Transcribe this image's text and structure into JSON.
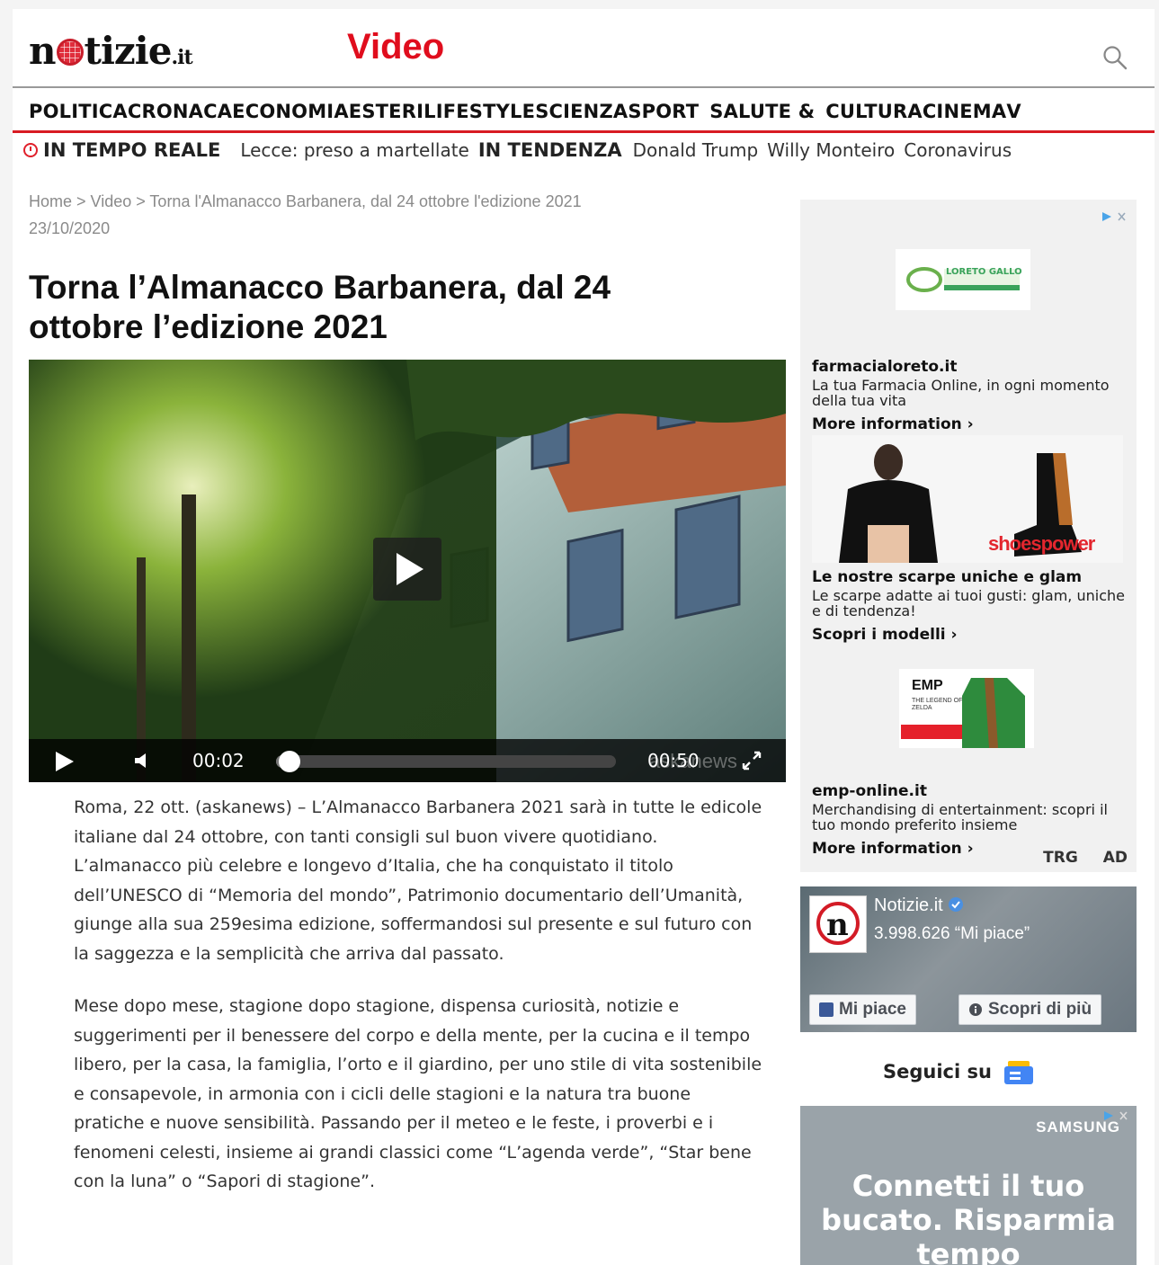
{
  "header": {
    "logo_text_left": "n",
    "logo_text_right": "tizie",
    "logo_tld": ".it",
    "section": "Video"
  },
  "nav": {
    "items": [
      "POLITICA",
      "CRONACA",
      "ECONOMIA",
      "ESTERI",
      "LIFESTYLE",
      "SCIENZA",
      "SPORT",
      "SALUTE &",
      "CULTURA",
      "CINEMA",
      "V"
    ]
  },
  "ticker": {
    "realtime_label": "IN TEMPO REALE",
    "realtime_item": "Lecce: preso a martellate",
    "trending_label": "IN TENDENZA",
    "trending_items": [
      "Donald Trump",
      "Willy Monteiro",
      "Coronavirus"
    ]
  },
  "breadcrumb": {
    "text": "Home > Video > Torna l'Almanacco Barbanera, dal 24 ottobre l'edizione 2021",
    "date": "23/10/2020"
  },
  "article": {
    "title": "Torna l’Almanacco Barbanera, dal 24 ottobre l’edizione 2021",
    "paragraphs": [
      "Roma, 22 ott. (askanews) – L’Almanacco Barbanera 2021 sarà in tutte le edicole italiane dal 24 ottobre, con tanti consigli sul buon vivere quotidiano. L’almanacco più celebre e longevo d’Italia, che ha conquistato il titolo dell’UNESCO di “Memoria del mondo”, Patrimonio documentario dell’Umanità, giunge alla sua 259esima edizione, soffermandosi sul presente e sul futuro con la saggezza e la semplicità che arriva dal passato.",
      "Mese dopo mese, stagione dopo stagione, dispensa curiosità, notizie e suggerimenti per il benessere del corpo e della mente, per la cucina e il tempo libero, per la casa, la famiglia, l’orto e il giardino, per uno stile di vita sostenibile e consapevole, in armonia con i cicli delle stagioni e la natura tra buone pratiche e nuove sensibilità. Passando per il meteo e le feste, i proverbi e i fenomeni celesti, insieme ai grandi classici come “L’agenda verde”, “Star bene con la luna” o “Sapori di stagione”."
    ]
  },
  "video": {
    "current_time": "00:02",
    "duration": "00:50",
    "progress": 0.04,
    "watermark": "askanews"
  },
  "ads": {
    "adchoice_icon": "adchoices-icon",
    "items": [
      {
        "logo_text": "LORETO GALLO",
        "title": "farmacialoreto.it",
        "text": "La tua Farmacia Online, in ogni momento della tua vita",
        "link": "More information ›"
      },
      {
        "brand": "shoespower",
        "title": "Le nostre scarpe uniche e glam",
        "text": "Le scarpe adatte ai tuoi gusti: glam, uniche e di tendenza!",
        "link": "Scopri i modelli ›"
      },
      {
        "logo_text": "EMP",
        "subtext": "THE LEGEND OF ZELDA",
        "title": "emp-online.it",
        "text": "Merchandising di entertainment: scopri il tuo mondo preferito insieme",
        "link": "More information ›"
      }
    ],
    "badges": [
      "TRG",
      "AD"
    ]
  },
  "facebook": {
    "page_name": "Notizie.it",
    "likes": "3.998.626 “Mi piace”",
    "like_button": "Mi piace",
    "more_button": "Scopri di più",
    "avatar_letter": "n"
  },
  "follow": {
    "label": "Seguici su"
  },
  "ad2": {
    "brand": "SAMSUNG",
    "headline": "Connetti il tuo bucato. Risparmia tempo"
  },
  "colors": {
    "brand_red": "#e00d1d",
    "nav_border": "#d81b23",
    "link_blue": "#4aa4e8"
  }
}
